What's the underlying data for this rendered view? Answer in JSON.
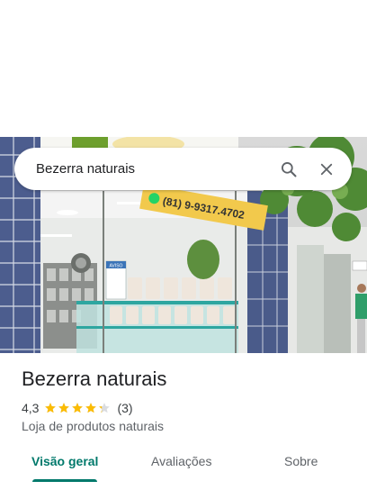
{
  "search": {
    "query": "Bezerra naturais",
    "search_icon": "search-icon",
    "close_icon": "close-icon"
  },
  "photo": {
    "sign_phone": "(81) 9-9317.4702",
    "notice_label": "AVISO"
  },
  "place": {
    "name": "Bezerra naturais",
    "rating": "4,3",
    "rating_value": 4.3,
    "reviews_count": "(3)",
    "category": "Loja de produtos naturais"
  },
  "tabs": [
    {
      "label": "Visão geral",
      "active": true
    },
    {
      "label": "Avaliações",
      "active": false
    },
    {
      "label": "Sobre",
      "active": false
    }
  ],
  "colors": {
    "accent": "#00796b",
    "star": "#fbbc04",
    "sign_yellow": "#f2c94c"
  }
}
